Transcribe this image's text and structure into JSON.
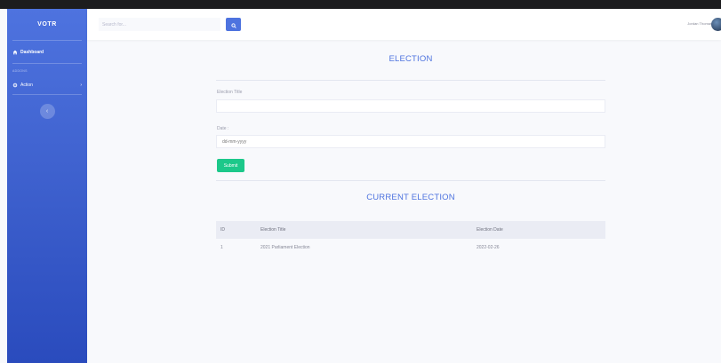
{
  "sidebar": {
    "brand": "VOTR",
    "dashboard_label": "Dashboard",
    "heading": "ADDONS",
    "action_label": "Action",
    "arrow": "›",
    "toggle_glyph": "‹"
  },
  "topbar": {
    "search_placeholder": "Search for...",
    "user_name": "Jordan Thomas"
  },
  "form": {
    "title": "ELECTION",
    "election_title_label": "Election Title",
    "election_title_value": "",
    "date_label": "Date :",
    "date_placeholder": "dd-mm-yyyy",
    "submit_label": "Submit"
  },
  "current": {
    "title": "CURRENT ELECTION",
    "columns": [
      "ID",
      "Election Title",
      "Election Date"
    ],
    "rows": [
      [
        "1",
        "2021 Parliament Election",
        "2022-02-26"
      ]
    ]
  },
  "colors": {
    "primary": "#4e73df",
    "success": "#1cc88a"
  }
}
